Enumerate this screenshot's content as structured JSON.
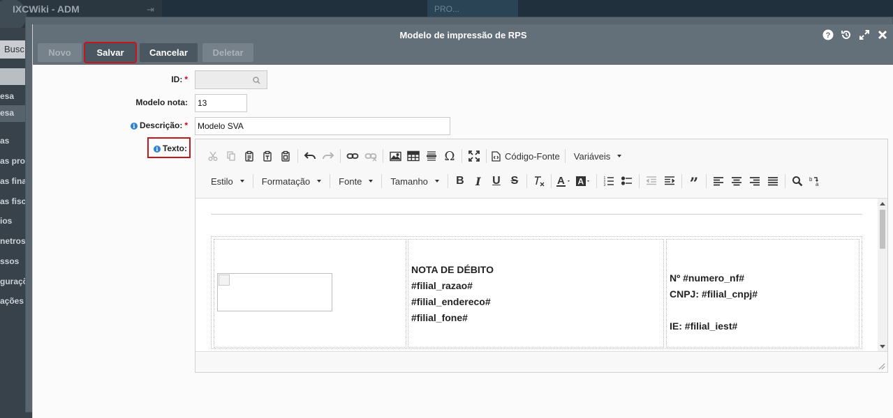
{
  "background": {
    "app_title": "IXCWiki - ADM",
    "tab_label": "PRO...",
    "search_label": "Busc",
    "sidebar_items": [
      "esa",
      "esa",
      "as",
      "as pro",
      "as fina",
      "as fisc",
      "ios",
      "netros",
      "ssos",
      "guraçõ",
      "ações"
    ]
  },
  "modal": {
    "title": "Modelo de impressão de RPS",
    "icons": [
      "help-icon",
      "history-icon",
      "expand-icon",
      "close-icon"
    ],
    "buttons": {
      "novo": "Novo",
      "salvar": "Salvar",
      "cancelar": "Cancelar",
      "deletar": "Deletar"
    }
  },
  "form": {
    "id_label": "ID:",
    "id_required": "*",
    "id_value": "",
    "modelo_nota_label": "Modelo nota:",
    "modelo_nota_value": "13",
    "descricao_label": "Descrição:",
    "descricao_required": "*",
    "descricao_value": "Modelo SVA",
    "texto_label": "Texto:"
  },
  "editor": {
    "toolbar": {
      "codigo_fonte": "Código-Fonte",
      "variaveis": "Variáveis",
      "estilo": "Estilo",
      "formatacao": "Formatação",
      "fonte": "Fonte",
      "tamanho": "Tamanho"
    },
    "document": {
      "col2_lines": [
        "NOTA DE DÉBITO",
        "#filial_razao#",
        "#filial_endereco#",
        "#filial_fone#"
      ],
      "col3_lines": [
        "Nº #numero_nf#",
        "CNPJ: #filial_cnpj#",
        "",
        "IE: #filial_iest#"
      ]
    }
  },
  "colors": {
    "header": "#636f79",
    "highlight": "#c4161c",
    "required": "#d0021b",
    "info": "#2f80d0"
  }
}
